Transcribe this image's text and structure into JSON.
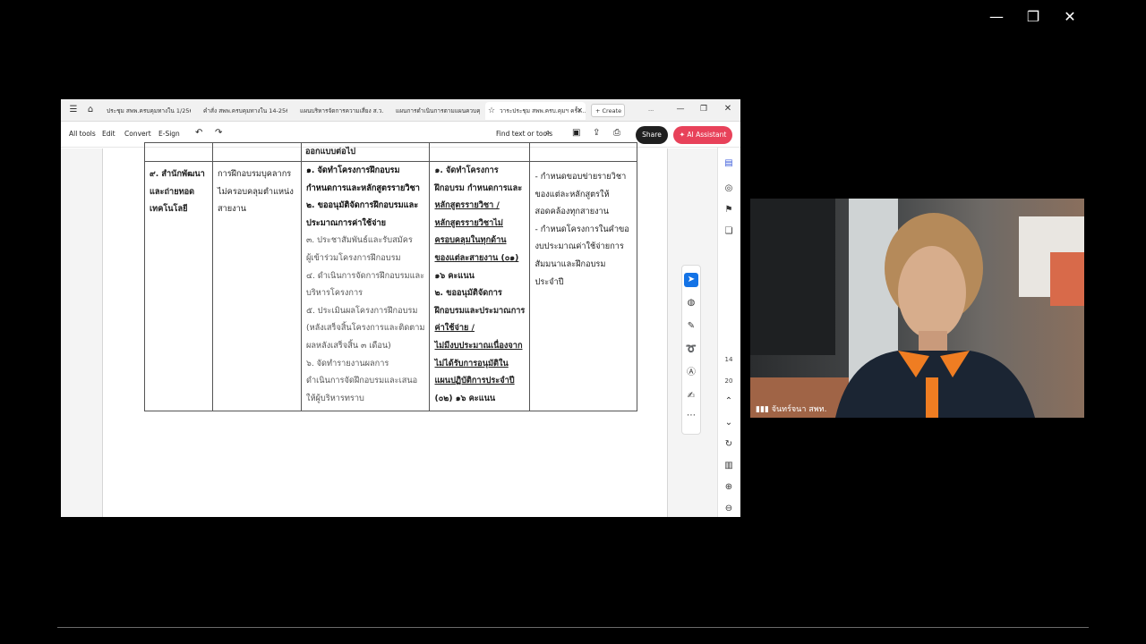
{
  "os": {
    "minimize": "—",
    "restore": "❐",
    "close": "✕"
  },
  "acrobat": {
    "tabs": [
      "ประชุม สพพ.ครบคุมทางใน 1/2568",
      "คำสั่ง สพพ.ครบคุมทางใน 14-2568...",
      "แผนบริหารจัดการความเสี่ยง ส.ว.ก. ...",
      "แผนการดำเนินการตามแผนควบคุมภายใน...",
      "วาระประชุม สพพ.ครบ.คุมฯ ครั้ง..."
    ],
    "create_label": "Create",
    "window_more": "···",
    "toolbar": {
      "all_tools": "All tools",
      "edit": "Edit",
      "convert": "Convert",
      "esign": "E-Sign",
      "find": "Find text or tools",
      "share": "Share",
      "ai": "AI Assistant"
    },
    "page_numbers": {
      "current": "14",
      "total": "20"
    },
    "colors": {
      "share_bg": "#1f1f1f",
      "ai_bg": "#e8425a",
      "selected_tool": "#1473e6"
    }
  },
  "table": {
    "header_text": "ออกแบบต่อไป",
    "col1": [
      "๙. สำนักพัฒนา",
      "และถ่ายทอด",
      "เทคโนโลยี"
    ],
    "col2": [
      "การฝึกอบรมบุคลากร",
      "ไม่ครอบคลุมตำแหน่ง",
      "สายงาน"
    ],
    "col3": [
      {
        "text": "๑. จัดทำโครงการฝึกอบรม",
        "bold": true
      },
      {
        "text": "กำหนดการและหลักสูตรรายวิชา",
        "bold": true
      },
      {
        "text": "๒. ขออนุมัติจัดการฝึกอบรมและ",
        "bold": true
      },
      {
        "text": "ประมาณการค่าใช้จ่าย",
        "bold": true
      },
      {
        "text": "๓. ประชาสัมพันธ์และรับสมัคร",
        "bold": false
      },
      {
        "text": "ผู้เข้าร่วมโครงการฝึกอบรม",
        "bold": false
      },
      {
        "text": "๔. ดำเนินการจัดการฝึกอบรมและ",
        "bold": false
      },
      {
        "text": "บริหารโครงการ",
        "bold": false
      },
      {
        "text": "๕. ประเมินผลโครงการฝึกอบรม",
        "bold": false
      },
      {
        "text": "(หลังเสร็จสิ้นโครงการและติดตาม",
        "bold": false
      },
      {
        "text": "ผลหลังเสร็จสิ้น ๓ เดือน)",
        "bold": false
      },
      {
        "text": "๖. จัดทำรายงานผลการ",
        "bold": false
      },
      {
        "text": "ดำเนินการจัดฝึกอบรมและเสนอ",
        "bold": false
      },
      {
        "text": "ให้ผู้บริหารทราบ",
        "bold": false
      }
    ],
    "col4": [
      {
        "text": "๑. จัดทำโครงการ",
        "u": false
      },
      {
        "text": "ฝึกอบรม กำหนดการและ",
        "u": false
      },
      {
        "text": "หลักสูตรรายวิชา /",
        "u": true
      },
      {
        "text": "หลักสูตรรายวิชาไม่",
        "u": true
      },
      {
        "text": "ครอบคลุมในทุกด้าน",
        "u": true
      },
      {
        "text": "ของแต่ละสายงาน (๐๑)",
        "u": true
      },
      {
        "text": "๑๖ คะแนน",
        "u": false
      },
      {
        "text": "๒. ขออนุมัติจัดการ",
        "u": false
      },
      {
        "text": "ฝึกอบรมและประมาณการ",
        "u": false
      },
      {
        "text": "ค่าใช้จ่าย /",
        "u": true
      },
      {
        "text": "ไม่มีงบประมาณเนื่องจาก",
        "u": true
      },
      {
        "text": "ไม่ได้รับการอนุมัติใน",
        "u": true
      },
      {
        "text": "แผนปฏิบัติการประจำปี",
        "u": true
      },
      {
        "text": "(๐๒) ๑๖ คะแนน",
        "u": false
      }
    ],
    "col5": [
      "- กำหนดขอบข่ายรายวิชา",
      "ของแต่ละหลักสูตรให้",
      "สอดคล้องทุกสายงาน",
      "- กำหนดโครงการในคำขอ",
      "งบประมาณค่าใช้จ่ายการ",
      "สัมมนาและฝึกอบรม",
      "ประจำปี"
    ]
  },
  "webcam": {
    "participant_name": "จันทร์จนา สพท."
  }
}
